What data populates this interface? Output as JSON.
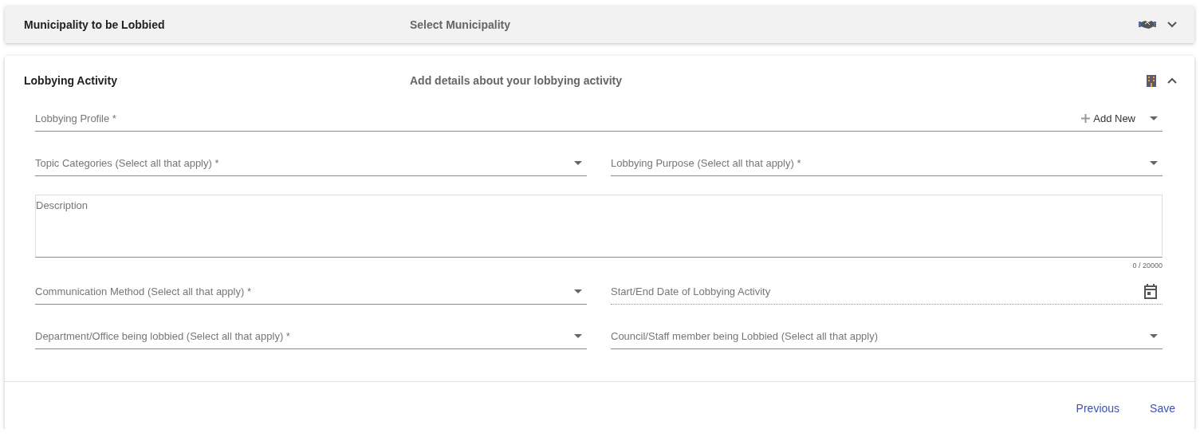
{
  "panels": [
    {
      "title": "Municipality to be Lobbied",
      "subtitle": "Select Municipality",
      "expanded": false
    },
    {
      "title": "Lobbying Activity",
      "subtitle": "Add details about your lobbying activity",
      "expanded": true,
      "rows": [
        [
          {
            "kind": "select-add",
            "label": "Lobbying Profile *",
            "action": "Add New"
          }
        ],
        [
          {
            "kind": "select",
            "label": "Topic Categories (Select all that apply) *"
          },
          {
            "kind": "select",
            "label": "Lobbying Purpose (Select all that apply) *"
          }
        ],
        [
          {
            "kind": "textarea",
            "label": "Description",
            "counter": "0 / 20000"
          }
        ],
        [
          {
            "kind": "select",
            "label": "Communication Method (Select all that apply) *"
          },
          {
            "kind": "date",
            "label": "Start/End Date of Lobbying Activity"
          }
        ],
        [
          {
            "kind": "select",
            "label": "Department/Office being lobbied (Select all that apply) *"
          },
          {
            "kind": "select",
            "label": "Council/Staff member being Lobbied (Select all that apply)"
          }
        ]
      ],
      "buttons": [
        "Previous",
        "Save"
      ]
    }
  ]
}
